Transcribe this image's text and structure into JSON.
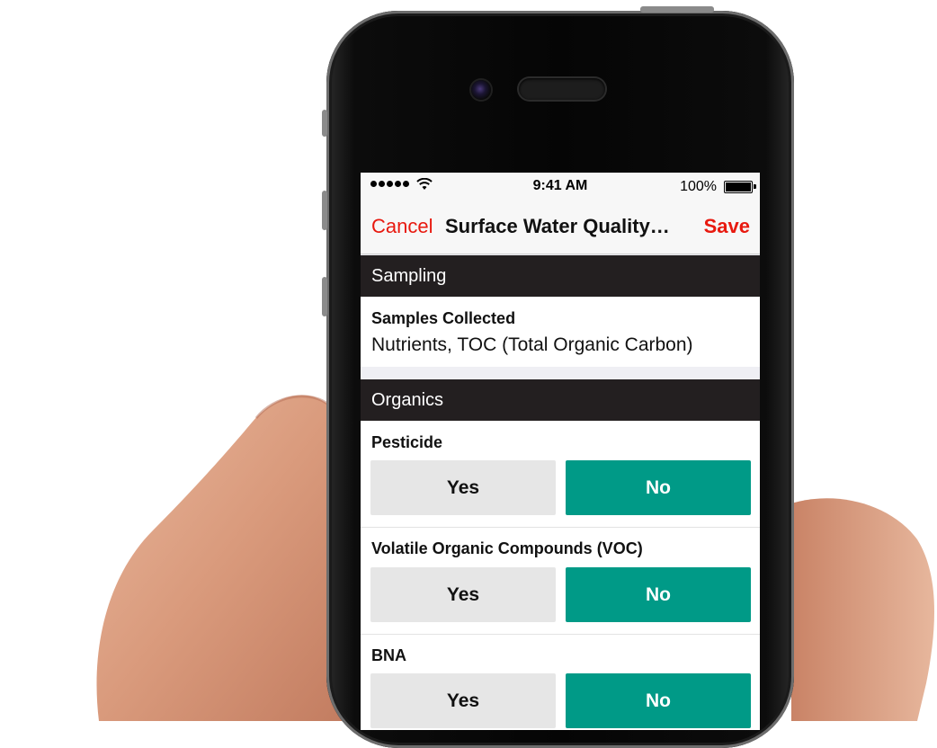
{
  "status_bar": {
    "time": "9:41 AM",
    "battery": "100%"
  },
  "nav": {
    "cancel_label": "Cancel",
    "title": "Surface Water Quality…",
    "save_label": "Save"
  },
  "sections": [
    {
      "title": "Sampling",
      "fields": [
        {
          "label": "Samples Collected",
          "value": "Nutrients, TOC (Total Organic Carbon)"
        }
      ]
    },
    {
      "title": "Organics",
      "fields": [
        {
          "label": "Pesticide",
          "yes_label": "Yes",
          "no_label": "No",
          "selected": "No"
        },
        {
          "label": "Volatile Organic Compounds (VOC)",
          "yes_label": "Yes",
          "no_label": "No",
          "selected": "No"
        },
        {
          "label": "BNA",
          "yes_label": "Yes",
          "no_label": "No",
          "selected": "No"
        }
      ]
    }
  ],
  "colors": {
    "accent_red": "#e8190f",
    "selected_teal": "#009a87",
    "unselected_gray": "#e6e6e6",
    "section_header_bg": "#231f20"
  },
  "icons": [
    "signal-dots-icon",
    "wifi-icon",
    "battery-icon"
  ]
}
